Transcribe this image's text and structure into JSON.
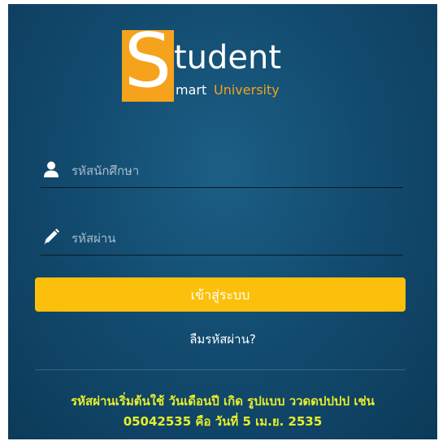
{
  "logo": {
    "letter": "S",
    "word": "tudent",
    "tagline_mart": "mart",
    "tagline_university": "University"
  },
  "form": {
    "username_placeholder": "รหัสนักศึกษา",
    "password_placeholder": "รหัสผ่าน",
    "login_label": "เข้าสู่ระบบ",
    "forgot_label": "ลืมรหัสผ่าน?"
  },
  "hint": {
    "line1": "รหัสผ่านเริ่มต้นใช้ วันเดือนปี เกิด รูปแบบ ววดดปปปป เช่น",
    "line2": "05042535 คือ วันที่ 5 เม.ย. 2535"
  },
  "colors": {
    "background": "#134c70",
    "accent_orange": "#f5a21d",
    "button": "#fcc00c",
    "hint_text": "#e6ee2a"
  },
  "icons": {
    "username": "user-icon",
    "password": "pencil-icon"
  }
}
